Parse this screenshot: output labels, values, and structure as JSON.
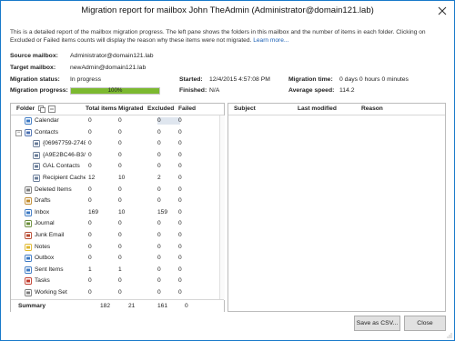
{
  "window": {
    "title": "Migration report for mailbox John TheAdmin (Administrator@domain121.lab)"
  },
  "description": {
    "text": "This is a detailed report of the mailbox migration progress. The left pane shows the folders in this mailbox and the number of items in each folder. Clicking on Excluded or Failed items counts will display the reason why these items were not migrated.",
    "link": "Learn more..."
  },
  "info": {
    "source_label": "Source mailbox:",
    "source_value": "Administrator@domain121.lab",
    "target_label": "Target mailbox:",
    "target_value": "newAdmin@domain121.lab",
    "status_label": "Migration status:",
    "status_value": "In progress",
    "progress_label": "Migration progress:",
    "progress_percent": 100,
    "progress_text": "100%",
    "started_label": "Started:",
    "started_value": "12/4/2015 4:57:08 PM",
    "finished_label": "Finished:",
    "finished_value": "N/A",
    "time_label": "Migration time:",
    "time_value": "0 days 0 hours 0 minutes",
    "speed_label": "Average speed:",
    "speed_value": "114.2"
  },
  "folders_grid": {
    "headers": {
      "folder": "Folder",
      "total": "Total items",
      "migrated": "Migrated",
      "excluded": "Excluded",
      "failed": "Failed"
    },
    "expander_symbol": "−",
    "rows": [
      {
        "name": "Calendar",
        "icon": "calendar-icon",
        "total": "0",
        "migrated": "0",
        "excluded": "0",
        "failed": "0"
      },
      {
        "name": "Contacts",
        "icon": "contacts-icon",
        "total": "0",
        "migrated": "0",
        "excluded": "0",
        "failed": "0"
      },
      {
        "name": "{06967759-2748",
        "icon": "contact-folder-icon",
        "total": "0",
        "migrated": "0",
        "excluded": "0",
        "failed": "0"
      },
      {
        "name": "{A9E2BC46-B3/",
        "icon": "contact-folder-icon",
        "total": "0",
        "migrated": "0",
        "excluded": "0",
        "failed": "0"
      },
      {
        "name": "GAL Contacts",
        "icon": "contact-folder-icon",
        "total": "0",
        "migrated": "0",
        "excluded": "0",
        "failed": "0"
      },
      {
        "name": "Recipient Cache",
        "icon": "contact-folder-icon",
        "total": "12",
        "migrated": "10",
        "excluded": "2",
        "failed": "0"
      },
      {
        "name": "Deleted Items",
        "icon": "deleted-items-icon",
        "total": "0",
        "migrated": "0",
        "excluded": "0",
        "failed": "0"
      },
      {
        "name": "Drafts",
        "icon": "drafts-icon",
        "total": "0",
        "migrated": "0",
        "excluded": "0",
        "failed": "0"
      },
      {
        "name": "Inbox",
        "icon": "inbox-icon",
        "total": "169",
        "migrated": "10",
        "excluded": "159",
        "failed": "0"
      },
      {
        "name": "Journal",
        "icon": "journal-icon",
        "total": "0",
        "migrated": "0",
        "excluded": "0",
        "failed": "0"
      },
      {
        "name": "Junk Email",
        "icon": "junk-email-icon",
        "total": "0",
        "migrated": "0",
        "excluded": "0",
        "failed": "0"
      },
      {
        "name": "Notes",
        "icon": "notes-icon",
        "total": "0",
        "migrated": "0",
        "excluded": "0",
        "failed": "0"
      },
      {
        "name": "Outbox",
        "icon": "outbox-icon",
        "total": "0",
        "migrated": "0",
        "excluded": "0",
        "failed": "0"
      },
      {
        "name": "Sent Items",
        "icon": "sent-items-icon",
        "total": "1",
        "migrated": "1",
        "excluded": "0",
        "failed": "0"
      },
      {
        "name": "Tasks",
        "icon": "tasks-icon",
        "total": "0",
        "migrated": "0",
        "excluded": "0",
        "failed": "0"
      },
      {
        "name": "Working Set",
        "icon": "working-set-icon",
        "total": "0",
        "migrated": "0",
        "excluded": "0",
        "failed": "0"
      }
    ],
    "summary": {
      "label": "Summary",
      "total": "182",
      "migrated": "21",
      "excluded": "161",
      "failed": "0"
    }
  },
  "details_grid": {
    "headers": {
      "subject": "Subject",
      "last_modified": "Last modified",
      "reason": "Reason"
    }
  },
  "buttons": {
    "save": "Save as CSV...",
    "close": "Close"
  },
  "colors": {
    "accent": "#1979ca",
    "progress_fill": "#7cb930",
    "link": "#1a5fb4"
  }
}
